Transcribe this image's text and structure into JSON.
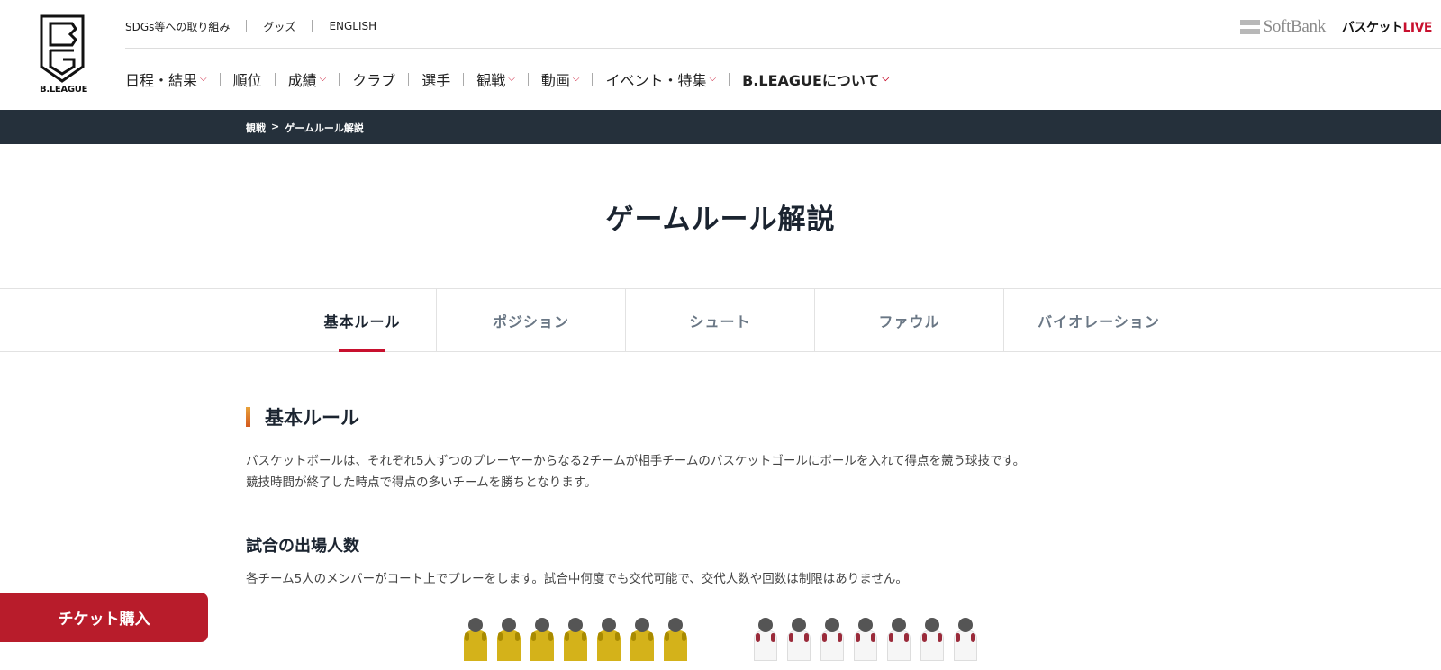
{
  "header": {
    "logo_text": "B.LEAGUE",
    "util_links": [
      "SDGs等への取り組み",
      "グッズ",
      "ENGLISH"
    ],
    "softbank": "SoftBank",
    "basket_live_prefix": "バスケット",
    "basket_live_suffix": "LIVE",
    "nav": [
      {
        "label": "日程・結果",
        "dropdown": true
      },
      {
        "label": "順位",
        "dropdown": false
      },
      {
        "label": "成績",
        "dropdown": true
      },
      {
        "label": "クラブ",
        "dropdown": false
      },
      {
        "label": "選手",
        "dropdown": false
      },
      {
        "label": "観戦",
        "dropdown": true
      },
      {
        "label": "動画",
        "dropdown": true
      },
      {
        "label": "イベント・特集",
        "dropdown": true
      },
      {
        "label": "B.LEAGUEについて",
        "dropdown": true
      }
    ]
  },
  "breadcrumb": {
    "parent": "観戦",
    "separator": ">",
    "current": "ゲームルール解説"
  },
  "page": {
    "title": "ゲームルール解説"
  },
  "tabs": [
    {
      "label": "基本ルール",
      "active": true
    },
    {
      "label": "ポジション",
      "active": false
    },
    {
      "label": "シュート",
      "active": false
    },
    {
      "label": "ファウル",
      "active": false
    },
    {
      "label": "バイオレーション",
      "active": false
    }
  ],
  "content": {
    "section_title": "基本ルール",
    "intro_line1": "バスケットボールは、それぞれ5人ずつのプレーヤーからなる2チームが相手チームのバスケットゴールにボールを入れて得点を競う球技です。",
    "intro_line2": "競技時間が終了した時点で得点の多いチームを勝ちとなります。",
    "subsection_title": "試合の出場人数",
    "subsection_text": "各チーム5人のメンバーがコート上でプレーをします。試合中何度でも交代可能で、交代人数や回数は制限はありません。",
    "team_a_players": 7,
    "team_b_players": 7
  },
  "ticket_button": "チケット購入",
  "colors": {
    "accent": "#c8102e",
    "breadcrumb_bg": "#25303b",
    "ticket_bg": "#b81c2b",
    "team_a": "#d4b21a",
    "team_b": "#f6f6f6"
  }
}
